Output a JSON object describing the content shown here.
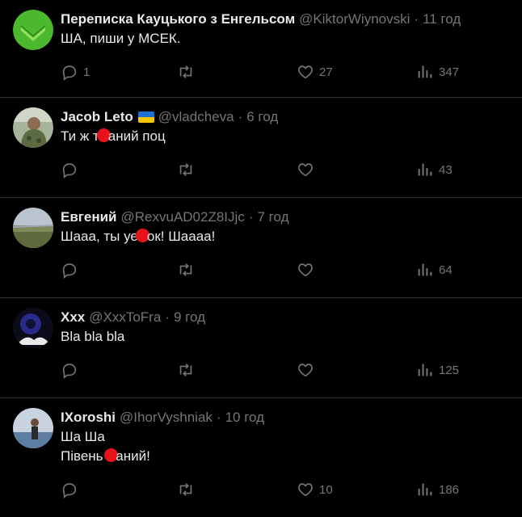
{
  "tweets": [
    {
      "name": "Переписка Кауцького з Енгельсом",
      "handle": "@KiktorWiynovski",
      "time": "11 год",
      "text_lines": [
        "ША, пиши у МСЕК."
      ],
      "replies": "1",
      "retweets": "",
      "likes": "27",
      "views": "347"
    },
    {
      "name": "Jacob Leto",
      "handle": "@vladcheva",
      "time": "6 год",
      "text_before": "Ти ж т",
      "text_after": "аний поц",
      "replies": "",
      "retweets": "",
      "likes": "",
      "views": "43"
    },
    {
      "name": "Евгений",
      "handle": "@RexvuAD02Z8IJjc",
      "time": "7 год",
      "text_before": "Шааа, ты уе",
      "text_after": "ок! Шаааа!",
      "replies": "",
      "retweets": "",
      "likes": "",
      "views": "64"
    },
    {
      "name": "Xxx",
      "handle": "@XxxToFra",
      "time": "9 год",
      "text_lines": [
        "Bla bla bla"
      ],
      "replies": "",
      "retweets": "",
      "likes": "",
      "views": "125"
    },
    {
      "name": "IXoroshi",
      "handle": "@IhorVyshniak",
      "time": "10 год",
      "text_line1": "Ша Ша",
      "text_before": "Півень ",
      "text_after": "аний!",
      "replies": "",
      "retweets": "",
      "likes": "10",
      "views": "186"
    }
  ],
  "separator": "·",
  "icons": {
    "reply": "reply-icon",
    "retweet": "retweet-icon",
    "like": "heart-icon",
    "views": "views-icon",
    "flag": "ukraine-flag-icon"
  },
  "colors": {
    "background": "#000000",
    "text": "#e7e9ea",
    "muted": "#71767b",
    "divider": "#2f3336",
    "flag_blue": "#1d6fd6",
    "flag_yellow": "#f7c600",
    "redaction": "#e8131a"
  }
}
